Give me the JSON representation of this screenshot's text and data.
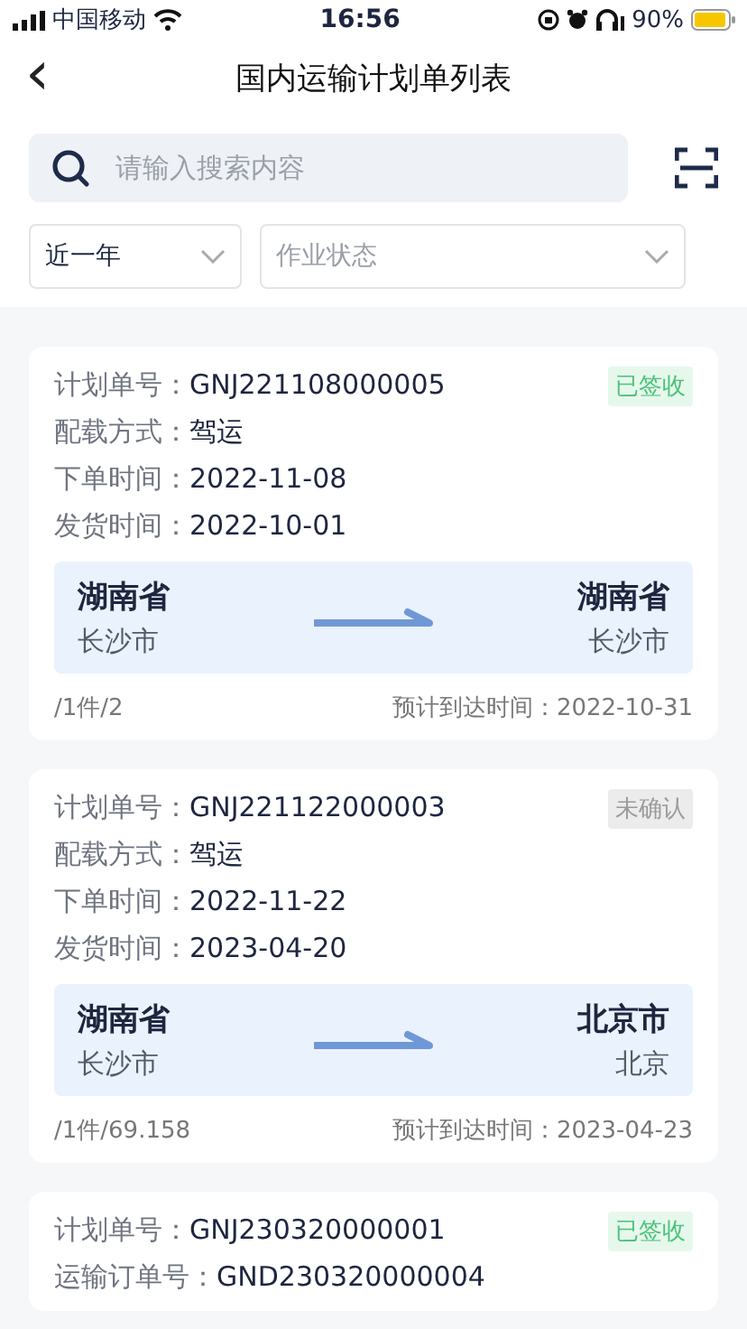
{
  "status_bar": {
    "carrier": "中国移动",
    "time": "16:56",
    "battery": "90%"
  },
  "header": {
    "back": "‹",
    "title": "国内运输计划单列表"
  },
  "search": {
    "placeholder": "请输入搜索内容"
  },
  "filters": [
    {
      "value": "近一年",
      "placeholder": false
    },
    {
      "value": "作业状态",
      "placeholder": true
    }
  ],
  "cards": [
    {
      "status": {
        "text": "已签收",
        "kind": "signed"
      },
      "fields": [
        {
          "label": "计划单号：",
          "value": "GNJ221108000005"
        },
        {
          "label": "配载方式：",
          "value": "驾运"
        },
        {
          "label": "下单时间：",
          "value": "2022-11-08"
        },
        {
          "label": "发货时间：",
          "value": "2022-10-01"
        }
      ],
      "route": {
        "from_province": "湖南省",
        "from_city": "长沙市",
        "to_province": "湖南省",
        "to_city": "长沙市"
      },
      "summary": "/1件/2",
      "eta": "预计到达时间：2022-10-31"
    },
    {
      "status": {
        "text": "未确认",
        "kind": "pending"
      },
      "fields": [
        {
          "label": "计划单号：",
          "value": "GNJ221122000003"
        },
        {
          "label": "配载方式：",
          "value": "驾运"
        },
        {
          "label": "下单时间：",
          "value": "2022-11-22"
        },
        {
          "label": "发货时间：",
          "value": "2023-04-20"
        }
      ],
      "route": {
        "from_province": "湖南省",
        "from_city": "长沙市",
        "to_province": "北京市",
        "to_city": "北京"
      },
      "summary": "/1件/69.158",
      "eta": "预计到达时间：2023-04-23"
    },
    {
      "status": {
        "text": "已签收",
        "kind": "signed"
      },
      "fields": [
        {
          "label": "计划单号：",
          "value": "GNJ230320000001"
        },
        {
          "label": "运输订单号：",
          "value": "GND230320000004"
        }
      ]
    }
  ]
}
